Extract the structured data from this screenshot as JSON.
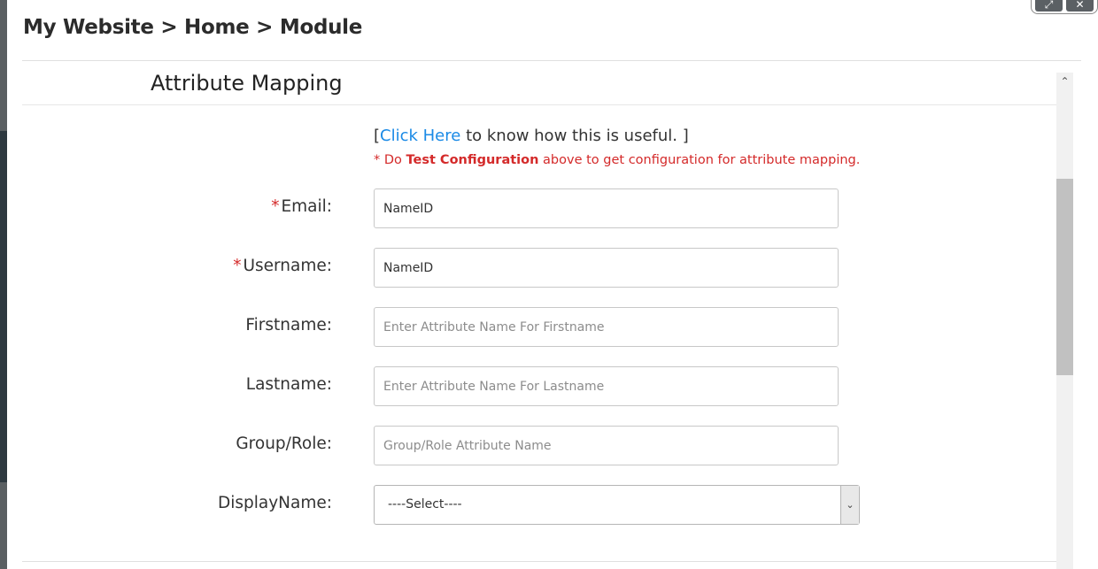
{
  "breadcrumb": "My Website > Home > Module",
  "window_controls": {
    "expand_glyph": "⤢",
    "close_glyph": "✕"
  },
  "section": {
    "title": "Attribute Mapping"
  },
  "help": {
    "prefix": "[",
    "link_text": "Click Here",
    "suffix": " to know how this is useful. ]"
  },
  "note": {
    "prefix": "* Do ",
    "bold": "Test Configuration",
    "suffix": " above to get configuration for attribute mapping."
  },
  "fields": {
    "email": {
      "label": "Email:",
      "required_mark": "*",
      "value": "NameID",
      "placeholder": ""
    },
    "username": {
      "label": "Username:",
      "required_mark": "*",
      "value": "NameID",
      "placeholder": ""
    },
    "firstname": {
      "label": "Firstname:",
      "value": "",
      "placeholder": "Enter Attribute Name For Firstname"
    },
    "lastname": {
      "label": "Lastname:",
      "value": "",
      "placeholder": "Enter Attribute Name For Lastname"
    },
    "group_role": {
      "label": "Group/Role:",
      "value": "",
      "placeholder": "Group/Role Attribute Name"
    },
    "display_name": {
      "label": "DisplayName:",
      "selected": "----Select----"
    }
  },
  "scrollbar": {
    "up_glyph": "⌃"
  },
  "select_arrow_glyph": "⌄"
}
